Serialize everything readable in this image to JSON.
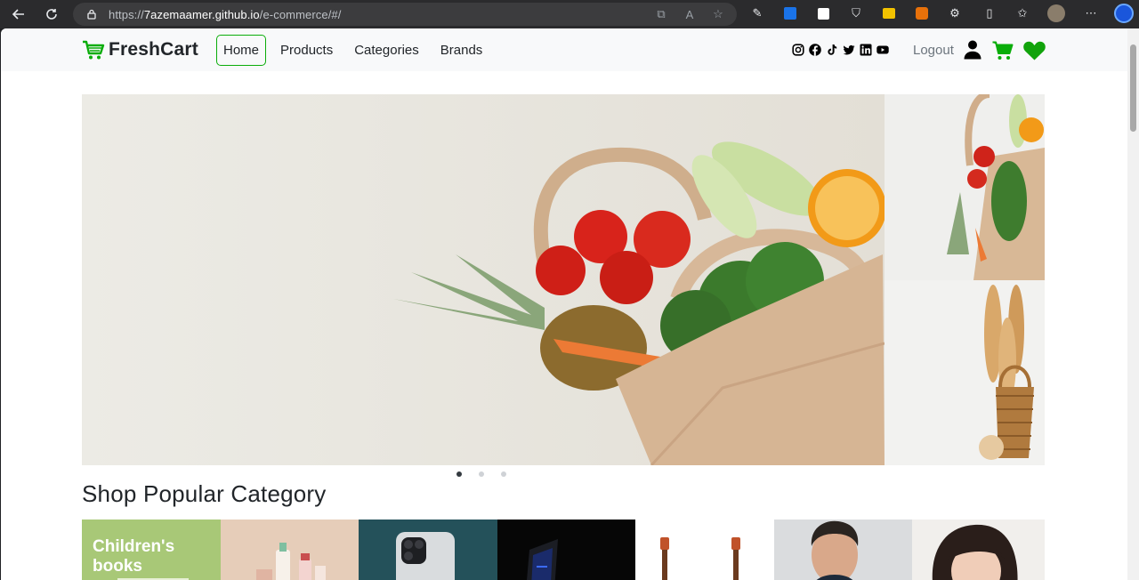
{
  "browser": {
    "url_scheme": "https://",
    "url_host": "7azemaamer.github.io",
    "url_path": "/e-commerce/#/"
  },
  "navbar": {
    "brand": "FreshCart",
    "links": [
      "Home",
      "Products",
      "Categories",
      "Brands"
    ],
    "active_link": "Home",
    "logout": "Logout",
    "social_icons": [
      "instagram-icon",
      "facebook-icon",
      "tiktok-icon",
      "twitter-icon",
      "linkedin-icon",
      "youtube-icon"
    ]
  },
  "slider": {
    "slide_count": 3,
    "active_slide": 1
  },
  "section": {
    "title": "Shop Popular Category"
  },
  "categories": {
    "first_label": "Children's books",
    "count_visible": 7
  },
  "colors": {
    "accent": "#0aad0a",
    "heart": "#11a30b"
  }
}
